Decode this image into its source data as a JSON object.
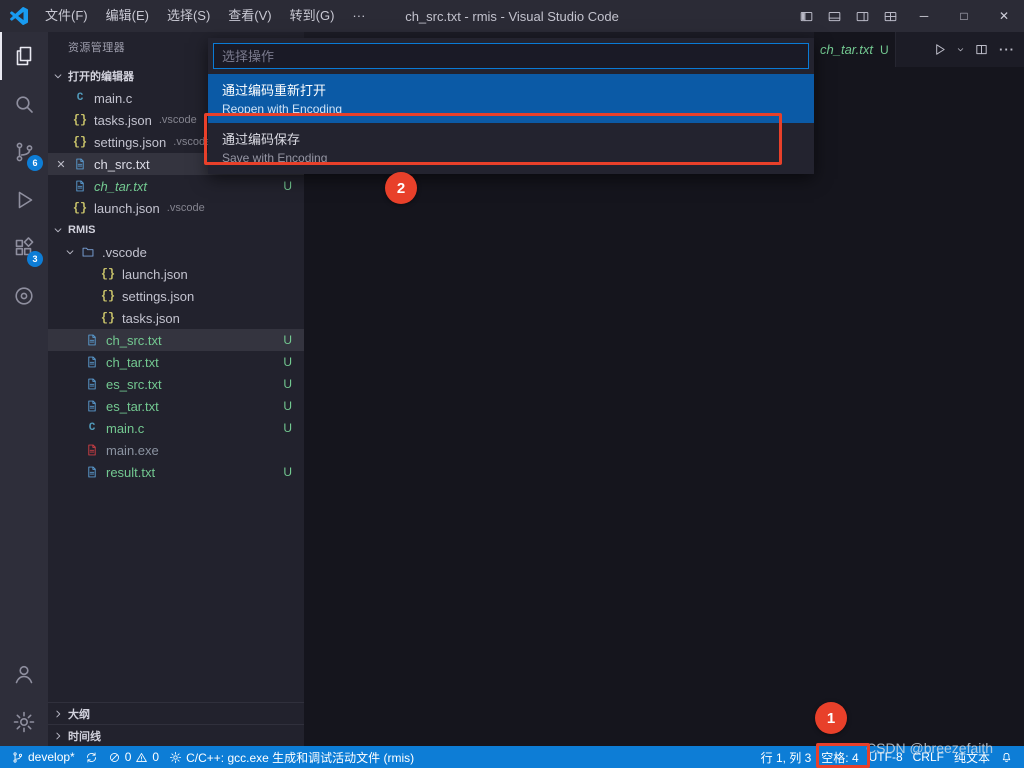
{
  "colors": {
    "status_bar_blue": "#0d7dd6",
    "accent_blue": "#0a7bd6",
    "quickpick_selection_blue": "#0b5aa6",
    "untracked_green": "#73c991",
    "annotation_red": "#e8402a"
  },
  "icons": {
    "more_menu": "···",
    "more_actions": "···",
    "minimize": "─",
    "maximize": "□",
    "close": "✕",
    "close_editor": "✕",
    "json_braces": "{}",
    "c_letter": "C"
  },
  "titlebar": {
    "menus": [
      "文件(F)",
      "编辑(E)",
      "选择(S)",
      "查看(V)",
      "转到(G)"
    ],
    "title": "ch_src.txt - rmis - Visual Studio Code"
  },
  "activity_bar": {
    "scm_badge": "6",
    "extensions_badge": "3"
  },
  "sidebar": {
    "title": "资源管理器",
    "open_editors": {
      "header": "打开的编辑器",
      "items": [
        {
          "label": "main.c"
        },
        {
          "label": "tasks.json",
          "desc": ".vscode"
        },
        {
          "label": "settings.json",
          "desc": ".vscode"
        },
        {
          "label": "ch_src.txt"
        },
        {
          "label": "ch_tar.txt",
          "badge": "U"
        },
        {
          "label": "launch.json",
          "desc": ".vscode"
        }
      ]
    },
    "explorer": {
      "header": "RMIS",
      "items": [
        {
          "label": ".vscode"
        },
        {
          "label": "launch.json"
        },
        {
          "label": "settings.json"
        },
        {
          "label": "tasks.json"
        },
        {
          "label": "ch_src.txt",
          "badge": "U"
        },
        {
          "label": "ch_tar.txt",
          "badge": "U"
        },
        {
          "label": "es_src.txt",
          "badge": "U"
        },
        {
          "label": "es_tar.txt",
          "badge": "U"
        },
        {
          "label": "main.c",
          "badge": "U"
        },
        {
          "label": "main.exe"
        },
        {
          "label": "result.txt",
          "badge": "U"
        }
      ]
    },
    "panes": [
      "大纲",
      "时间线"
    ]
  },
  "editor": {
    "tab": {
      "label": "ch_tar.txt",
      "badge": "U"
    }
  },
  "quick_pick": {
    "placeholder": "选择操作",
    "items": [
      {
        "label": "通过编码重新打开",
        "detail": "Reopen with Encoding"
      },
      {
        "label": "通过编码保存",
        "detail": "Save with Encoding"
      }
    ]
  },
  "status_bar": {
    "branch": "develop*",
    "errors": "0",
    "warnings": "0",
    "build_task": "C/C++: gcc.exe 生成和调试活动文件 (rmis)",
    "cursor": "行 1, 列 3",
    "indent": "空格: 4",
    "encoding": "UTF-8",
    "eol": "CRLF",
    "language": "纯文本"
  },
  "annotations": {
    "step1": "1",
    "step2": "2",
    "watermark": "CSDN @breezefaith"
  }
}
